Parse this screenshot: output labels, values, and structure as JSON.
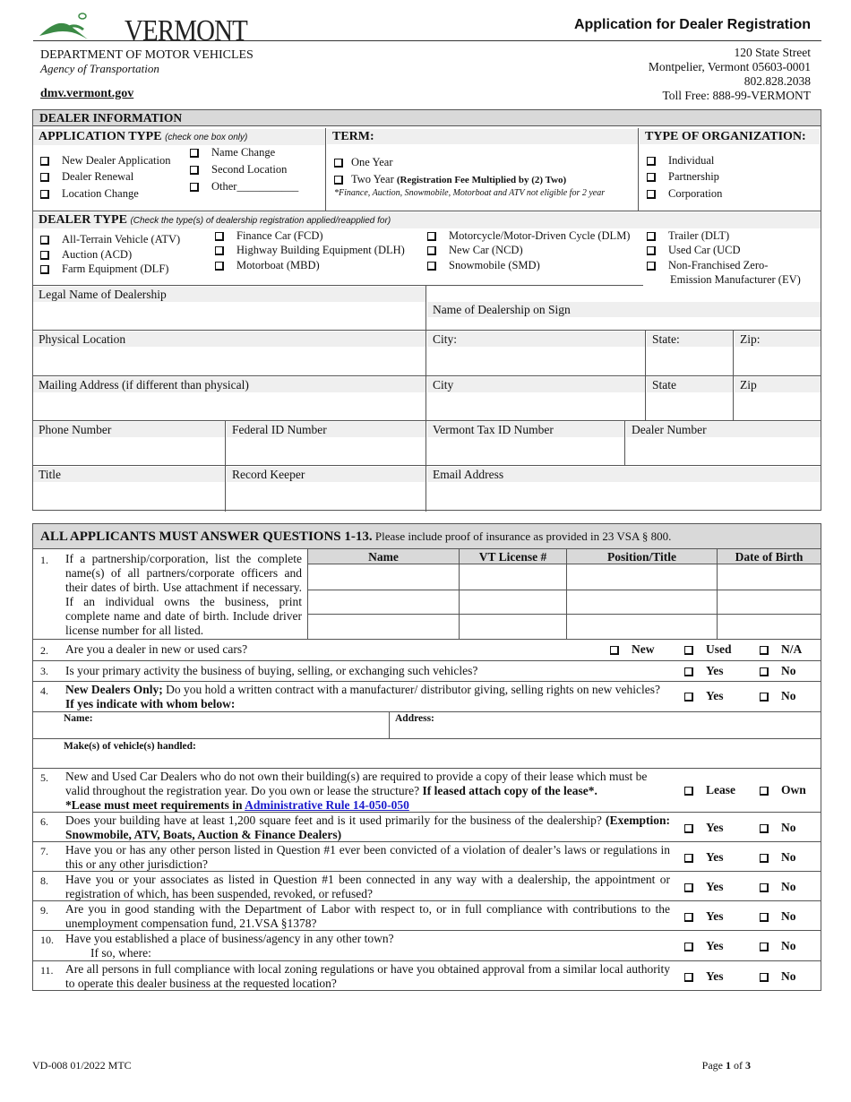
{
  "header": {
    "logo_text": "VERMONT",
    "form_title": "Application for Dealer Registration",
    "department": "DEPARTMENT OF MOTOR VEHICLES",
    "agency": "Agency of Transportation",
    "website": "dmv.vermont.gov",
    "address": [
      "120 State Street",
      "Montpelier, Vermont 05603-0001",
      "802.828.2038",
      "Toll Free:  888-99-VERMONT"
    ]
  },
  "dealer_info": {
    "title": "DEALER INFORMATION",
    "application_type": {
      "label": "APPLICATION TYPE",
      "hint": "(check one box only)",
      "options": [
        "New Dealer Application",
        "Dealer Renewal",
        "Location Change",
        "Name Change",
        "Second Location",
        "Other___________"
      ]
    },
    "term": {
      "label": "TERM:",
      "options": [
        "One Year",
        "Two Year"
      ],
      "two_year_note": "(Registration Fee Multiplied by (2) Two)",
      "footnote": "*Finance, Auction, Snowmobile, Motorboat and ATV not eligible for 2 year"
    },
    "organization": {
      "label": "TYPE OF ORGANIZATION:",
      "options": [
        "Individual",
        "Partnership",
        "Corporation"
      ]
    },
    "dealer_type": {
      "label": "DEALER TYPE",
      "hint": "(Check the type(s) of dealership registration applied/reapplied for)",
      "options": [
        "All-Terrain Vehicle (ATV)",
        "Auction (ACD)",
        "Farm Equipment (DLF)",
        "Finance Car (FCD)",
        "Highway Building Equipment (DLH)",
        "Motorboat (MBD)",
        "Motorcycle/Motor-Driven Cycle (DLM)",
        "New Car (NCD)",
        "Snowmobile (SMD)",
        "Trailer (DLT)",
        "Used Car (UCD",
        "Non-Franchised Zero-",
        "Emission Manufacturer (EV)"
      ]
    },
    "fields": {
      "legal_name": "Legal Name of Dealership",
      "sign_name": "Name of Dealership on Sign",
      "physical_location": "Physical Location",
      "city1": "City:",
      "state1": "State:",
      "zip1": "Zip:",
      "mailing": "Mailing Address (if different than physical)",
      "city2": "City",
      "state2": "State",
      "zip2": "Zip",
      "phone": "Phone Number",
      "federal_id": "Federal ID Number",
      "vt_tax_id": "Vermont Tax ID Number",
      "dealer_number": "Dealer Number",
      "title": "Title",
      "record_keeper": "Record Keeper",
      "email": "Email Address"
    }
  },
  "questions": {
    "heading_bold": "ALL APPLICANTS MUST ANSWER QUESTIONS 1-13.",
    "heading_rest": " Please include proof of insurance as provided in 23 VSA § 800.",
    "q1": {
      "num": "1.",
      "text": "If a partnership/corporation, list the complete name(s) of all partners/corporate officers and their dates of birth. Use attachment if necessary.  If an individual owns the business, print complete name and date of birth.  Include driver license number for all listed.",
      "columns": [
        "Name",
        "VT License #",
        "Position/Title",
        "Date of Birth"
      ]
    },
    "q2": {
      "num": "2.",
      "text": "Are you a dealer in new or used cars?",
      "answers": [
        "New",
        "Used",
        "N/A"
      ]
    },
    "q3": {
      "num": "3.",
      "text": "Is your primary activity the business of buying, selling, or exchanging such vehicles?",
      "answers": [
        "Yes",
        "No"
      ]
    },
    "q4": {
      "num": "4.",
      "text_bold": "New Dealers Only;",
      "text": " Do you hold a written contract with a manufacturer/ distributor giving, selling rights on new vehicles?",
      "text_bold2": "If yes indicate with whom below:",
      "answers": [
        "Yes",
        "No"
      ],
      "name_label": "Name:",
      "address_label": "Address:",
      "makes_label": "Make(s) of vehicle(s) handled:"
    },
    "q5": {
      "num": "5.",
      "text": "New and Used Car Dealers who do not own their building(s) are required to provide a copy of their lease which must be valid throughout the registration year. Do you own or lease the structure? ",
      "text_bold": "If leased attach copy of the lease*.",
      "note_bold": "*Lease must meet requirements in ",
      "link": "Administrative Rule 14-050-050",
      "answers": [
        "Lease",
        "Own"
      ]
    },
    "q6": {
      "num": "6.",
      "text": "Does your building have at least 1,200 square feet and is it used primarily for the business of the dealership? ",
      "text_bold": "(Exemption: Snowmobile, ATV, Boats, Auction & Finance Dealers)",
      "answers": [
        "Yes",
        "No"
      ]
    },
    "q7": {
      "num": "7.",
      "text": "Have you or has any other person listed in Question #1 ever been convicted of a violation of dealer’s laws or regulations in this or any other jurisdiction?",
      "answers": [
        "Yes",
        "No"
      ]
    },
    "q8": {
      "num": "8.",
      "text": "Have you or your associates as listed in Question #1 been connected in any way with a dealership, the appointment or registration of which, has been suspended, revoked, or refused?",
      "answers": [
        "Yes",
        "No"
      ]
    },
    "q9": {
      "num": "9.",
      "text": "Are you in good standing with the Department of Labor with respect to, or in full compliance with contributions to the unemployment compensation fund, 21.VSA §1378?",
      "answers": [
        "Yes",
        "No"
      ]
    },
    "q10": {
      "num": "10.",
      "text": "Have you established a place of business/agency in any other town?",
      "subtext": "If so, where:",
      "answers": [
        "Yes",
        "No"
      ]
    },
    "q11": {
      "num": "11.",
      "text": "Are all persons in full compliance with local zoning regulations or have you obtained approval from a similar local authority to operate this dealer business at the requested location?",
      "answers": [
        "Yes",
        "No"
      ]
    }
  },
  "footer": {
    "form_id": "VD-008 01/2022 MTC",
    "page_prefix": "Page ",
    "page_num": "1",
    "page_mid": " of ",
    "page_total": "3"
  }
}
